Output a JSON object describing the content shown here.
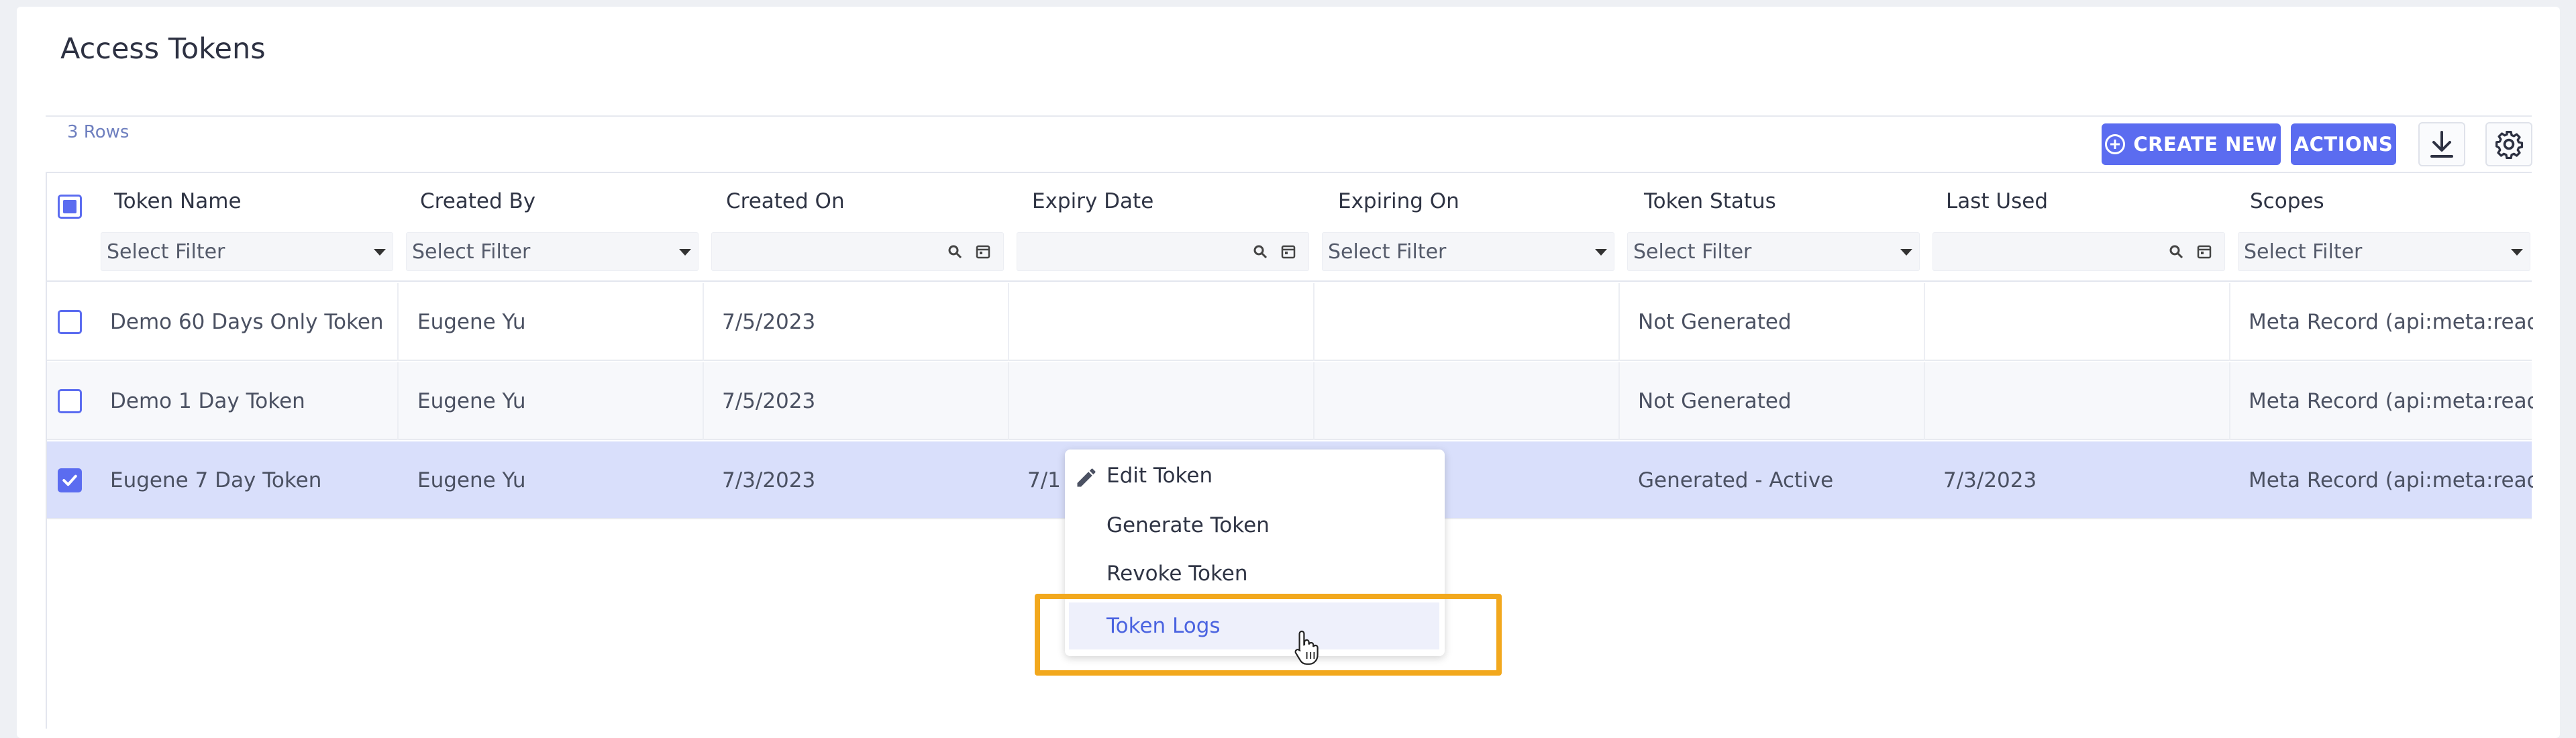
{
  "page": {
    "title": "Access Tokens"
  },
  "toolbar": {
    "row_count": "3 Rows",
    "create_label": "CREATE NEW",
    "actions_label": "ACTIONS",
    "download_icon": "download-icon",
    "settings_icon": "gear-icon",
    "accent_color": "#5b6cf0"
  },
  "columns": [
    {
      "title": "Token Name",
      "filter": "Select Filter",
      "filter_type": "select"
    },
    {
      "title": "Created By",
      "filter": "Select Filter",
      "filter_type": "select"
    },
    {
      "title": "Created On",
      "filter": "",
      "filter_type": "date"
    },
    {
      "title": "Expiry Date",
      "filter": "",
      "filter_type": "date"
    },
    {
      "title": "Expiring On",
      "filter": "Select Filter",
      "filter_type": "select"
    },
    {
      "title": "Token Status",
      "filter": "Select Filter",
      "filter_type": "select"
    },
    {
      "title": "Last Used",
      "filter": "",
      "filter_type": "date"
    },
    {
      "title": "Scopes",
      "filter": "Select Filter",
      "filter_type": "select"
    }
  ],
  "rows": [
    {
      "checked": false,
      "cells": [
        "Demo 60 Days Only Token",
        "Eugene Yu",
        "7/5/2023",
        "",
        "",
        "Not Generated",
        "",
        "Meta Record (api:meta:read)..."
      ]
    },
    {
      "checked": false,
      "cells": [
        "Demo 1 Day Token",
        "Eugene Yu",
        "7/5/2023",
        "",
        "",
        "Not Generated",
        "",
        "Meta Record (api:meta:read)..."
      ]
    },
    {
      "checked": true,
      "cells": [
        "Eugene 7 Day Token",
        "Eugene Yu",
        "7/3/2023",
        "7/1",
        "",
        "Generated - Active",
        "7/3/2023",
        "Meta Record (api:meta:read)..."
      ]
    }
  ],
  "context_menu": {
    "items": [
      {
        "label": "Edit Token",
        "icon": "pencil-icon"
      },
      {
        "label": "Generate Token"
      },
      {
        "label": "Revoke Token"
      },
      {
        "label": "Token Logs",
        "hovered": true
      }
    ],
    "highlight_color": "#f2a81d"
  }
}
